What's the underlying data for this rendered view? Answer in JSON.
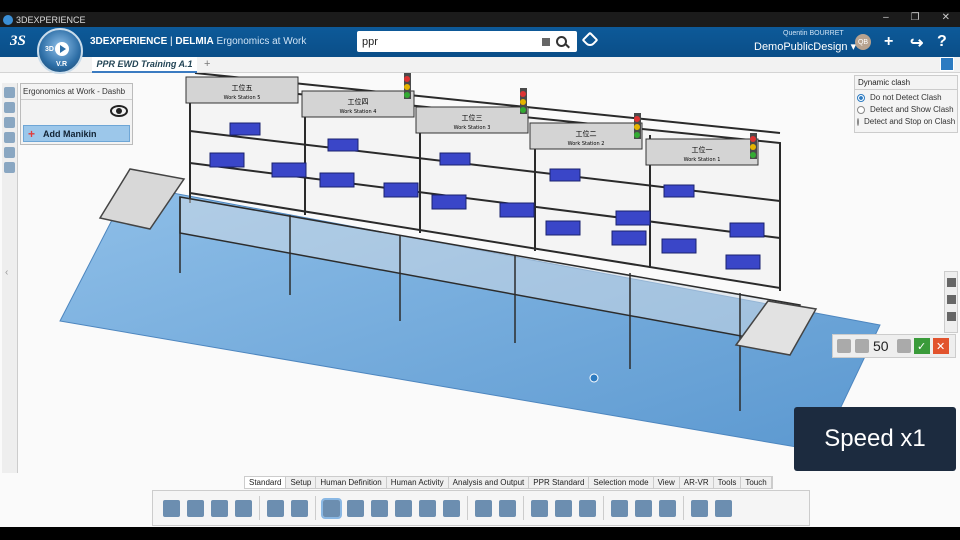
{
  "titlebar": {
    "title": "3DEXPERIENCE",
    "controls": [
      "–",
      "❐",
      "✕"
    ]
  },
  "compass": {
    "label_3d": "3D",
    "version": "V.R"
  },
  "header": {
    "brand": "3DEXPERIENCE",
    "separator": " | ",
    "app": "DELMIA",
    "module": "Ergonomics at Work",
    "search_value": "ppr",
    "user_name": "Quentin BOURRET",
    "collab_space": "DemoPublicDesign",
    "avatar_initials": "QB",
    "icons": [
      "tag-icon",
      "add-icon",
      "share-icon",
      "help-icon"
    ],
    "add_label": "+",
    "share_label": "↪",
    "help_label": "?"
  },
  "tabs": {
    "active": "PPR EWD Training A.1",
    "add": "+"
  },
  "left_panel": {
    "title": "Ergonomics at Work - Dashb",
    "add_manikin": "Add Manikin"
  },
  "clash_panel": {
    "title": "Dynamic clash",
    "options": [
      {
        "label": "Do not Detect Clash",
        "selected": true
      },
      {
        "label": "Detect and Show Clash",
        "selected": false
      },
      {
        "label": "Detect and Stop on Clash",
        "selected": false
      }
    ]
  },
  "manikin_bar": {
    "percentile": "50",
    "ok": "✓",
    "cancel": "✕"
  },
  "speed_badge": "Speed x1",
  "scene": {
    "stations": [
      {
        "cn": "工位五",
        "en": "Work Station 5"
      },
      {
        "cn": "工位四",
        "en": "Work Station 4"
      },
      {
        "cn": "工位三",
        "en": "Work Station 3"
      },
      {
        "cn": "工位二",
        "en": "Work Station 2"
      },
      {
        "cn": "工位一",
        "en": "Work Station 1"
      }
    ],
    "colors": {
      "floor": "#6fa8dc",
      "frame": "#3a3a3a",
      "bins": "#3a46c8",
      "conveyor": "#8ab4d8"
    }
  },
  "action_tabs": [
    "Standard",
    "Setup",
    "Human Definition",
    "Human Activity",
    "Analysis and Output",
    "PPR Standard",
    "Selection mode",
    "View",
    "AR-VR",
    "Tools",
    "Touch"
  ],
  "action_icons": [
    "cut-icon",
    "copy-icon",
    "paste-icon",
    "undo-icon",
    "sep",
    "manikin-icon",
    "posture-icon",
    "sep",
    "select-icon",
    "move-icon",
    "reach-icon",
    "grasp-icon",
    "rotate-icon",
    "hand-icon",
    "sep",
    "walk-icon",
    "compass-icon",
    "sep",
    "ik-icon",
    "pose-icon",
    "bend-icon",
    "sep",
    "lift-icon",
    "posture-analysis-icon",
    "rula-icon",
    "sep",
    "tool-icon",
    "camera-icon"
  ]
}
